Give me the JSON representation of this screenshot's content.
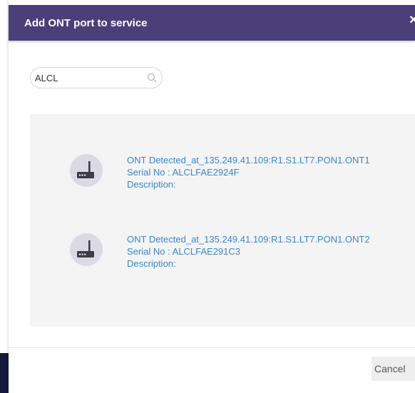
{
  "dialog": {
    "title": "Add ONT port to service",
    "close_glyph": "×"
  },
  "search": {
    "value": "ALCL",
    "icon": "search-icon"
  },
  "results": [
    {
      "icon": "router-icon",
      "name": "ONT Detected_at_135.249.41.109:R1.S1.LT7.PON1.ONT1",
      "serial": "Serial No : ALCLFAE2924F",
      "description": "Description:"
    },
    {
      "icon": "router-icon",
      "name": "ONT Detected_at_135.249.41.109:R1.S1.LT7.PON1.ONT2",
      "serial": "Serial No : ALCLFAE291C3",
      "description": "Description:"
    }
  ],
  "footer": {
    "cancel_label": "Cancel"
  },
  "colors": {
    "header_bg": "#4a3f78",
    "link_text": "#3a86c9",
    "panel_bg": "#f4f4f5",
    "icon_circle": "#dcd9e7",
    "device_dark": "#3c3c46"
  }
}
